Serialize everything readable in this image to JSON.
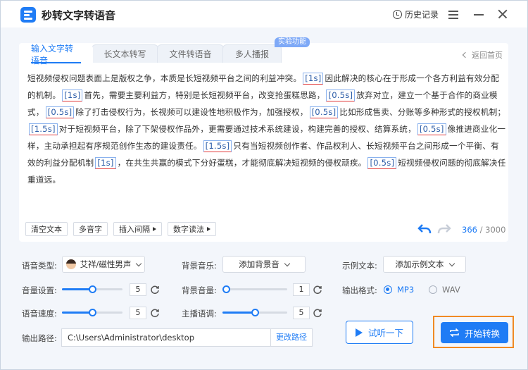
{
  "app": {
    "title": "秒转文字转语音"
  },
  "header": {
    "history_label": "历史记录"
  },
  "tabs": [
    {
      "label": "输入文字转语音"
    },
    {
      "label": "长文本转写"
    },
    {
      "label": "文件转语音"
    },
    {
      "label": "多人播报"
    }
  ],
  "badge": "实验功能",
  "back_home": "返回首页",
  "text": {
    "segments": [
      {
        "t": "短视频侵权问题表面上是版权之争，本质是长短视频平台之间的利益冲突。"
      },
      {
        "p": "[1s]"
      },
      {
        "t": "因此解决的核心在于形成一个各方利益有效分配的机制。"
      },
      {
        "p": "[1s]"
      },
      {
        "t": "首先，需要主要利益方，特别是长短视频平台，改变抢蛋糕思路，"
      },
      {
        "p": "[0.5s]"
      },
      {
        "t": "放弃对立，建立一个基于合作的商业模式，"
      },
      {
        "p": "[0.5s]"
      },
      {
        "t": "除了打击侵权行为，长视频可以建设性地积极作为，加强授权，"
      },
      {
        "p": "[0.5s]"
      },
      {
        "t": "比如形成售卖、分账等多种形式的授权机制；"
      },
      {
        "p": "[1.5s]"
      },
      {
        "t": "对于短视频平台，除了下架侵权作品外，更需要通过技术系统建设，构建完善的授权、结算系统，"
      },
      {
        "p": "[0.5s]"
      },
      {
        "t": "像推进商业化一样，主动承担起有序规范创作生态的建设责任。"
      },
      {
        "p": "[1.5s]"
      },
      {
        "t": "只有当短视频创作者、作品权利人、长短视频平台之间形成一个平衡、有效的利益分配机制"
      },
      {
        "p": "[1s]"
      },
      {
        "t": "，在共生共赢的模式下分好蛋糕，才能彻底解决短视频的侵权顽疾。"
      },
      {
        "p": "[0.5s]"
      },
      {
        "t": "短视频侵权问题的彻底解决任重道远。"
      }
    ]
  },
  "toolbar": {
    "clear": "清空文本",
    "polyphone": "多音字",
    "insert_pause": "插入间隔",
    "digit_reading": "数字读法"
  },
  "counter": {
    "current": "366",
    "sep": " / ",
    "max": "3000"
  },
  "settings": {
    "voice_type_label": "语音类型:",
    "voice_type_value": "艾祥/磁性男声",
    "bg_music_label": "背景音乐:",
    "bg_music_value": "添加背景音",
    "example_label": "示例文本:",
    "example_value": "添加示例文本",
    "volume_label": "音量设置:",
    "volume_value": "5",
    "volume_level": 0.5,
    "bg_volume_label": "背景音量:",
    "bg_volume_value": "1",
    "bg_volume_level": 0.0,
    "format_label": "输出格式:",
    "format_mp3": "MP3",
    "format_wav": "WAV",
    "speed_label": "语音速度:",
    "speed_value": "5",
    "speed_level": 0.5,
    "pitch_label": "主播语调:",
    "pitch_value": "5",
    "pitch_level": 0.5,
    "output_label": "输出路径:",
    "output_path": "C:\\Users\\Administrator\\desktop",
    "change_path": "更改路径"
  },
  "actions": {
    "preview": "试听一下",
    "start": "开始转换"
  },
  "colors": {
    "accent": "#1f7cf5",
    "highlight": "#f08a24",
    "pause_underline": "#e23b3b"
  }
}
